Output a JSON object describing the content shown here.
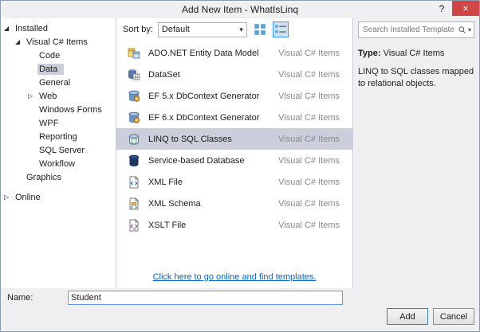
{
  "window": {
    "title": "Add New Item - WhatIsLinq"
  },
  "icons": {
    "help": "?",
    "close": "×",
    "dropdown_arrow": "▾",
    "search_dropdown_arrow": "▾",
    "expanded": "◢",
    "collapsed": "▷"
  },
  "tree": {
    "items": [
      {
        "label": "Installed",
        "arrow_glyph": "◢"
      },
      {
        "label": "Visual C# Items",
        "arrow_glyph": "◢"
      },
      {
        "label": "Code"
      },
      {
        "label": "Data",
        "selected": true
      },
      {
        "label": "General"
      },
      {
        "label": "Web",
        "arrow_glyph": "▷"
      },
      {
        "label": "Windows Forms"
      },
      {
        "label": "WPF"
      },
      {
        "label": "Reporting"
      },
      {
        "label": "SQL Server"
      },
      {
        "label": "Workflow"
      },
      {
        "label": "Graphics"
      },
      {
        "label": "Online",
        "arrow_glyph": "▷"
      }
    ]
  },
  "toolbar": {
    "sort_label": "Sort by:",
    "sort_value": "Default"
  },
  "templates": [
    {
      "name": "ADO.NET Entity Data Model",
      "type": "Visual C# Items"
    },
    {
      "name": "DataSet",
      "type": "Visual C# Items"
    },
    {
      "name": "EF 5.x DbContext Generator",
      "type": "Visual C# Items"
    },
    {
      "name": "EF 6.x DbContext Generator",
      "type": "Visual C# Items"
    },
    {
      "name": "LINQ to SQL Classes",
      "type": "Visual C# Items",
      "selected": true
    },
    {
      "name": "Service-based Database",
      "type": "Visual C# Items"
    },
    {
      "name": "XML File",
      "type": "Visual C# Items"
    },
    {
      "name": "XML Schema",
      "type": "Visual C# Items"
    },
    {
      "name": "XSLT File",
      "type": "Visual C# Items"
    }
  ],
  "center": {
    "online_link": "Click here to go online and find templates."
  },
  "search": {
    "placeholder": "Search Installed Templates (Ctrl+E)"
  },
  "info": {
    "type_label": "Type:",
    "type_value": "Visual C# Items",
    "description": "LINQ to SQL classes mapped to relational objects."
  },
  "footer": {
    "name_label": "Name:",
    "name_value": "Student",
    "add_label": "Add",
    "cancel_label": "Cancel"
  },
  "colors": {
    "selection": "#CCCEDB",
    "close_button": "#D04545",
    "link": "#0066CC",
    "focus_border": "#569DE5"
  }
}
